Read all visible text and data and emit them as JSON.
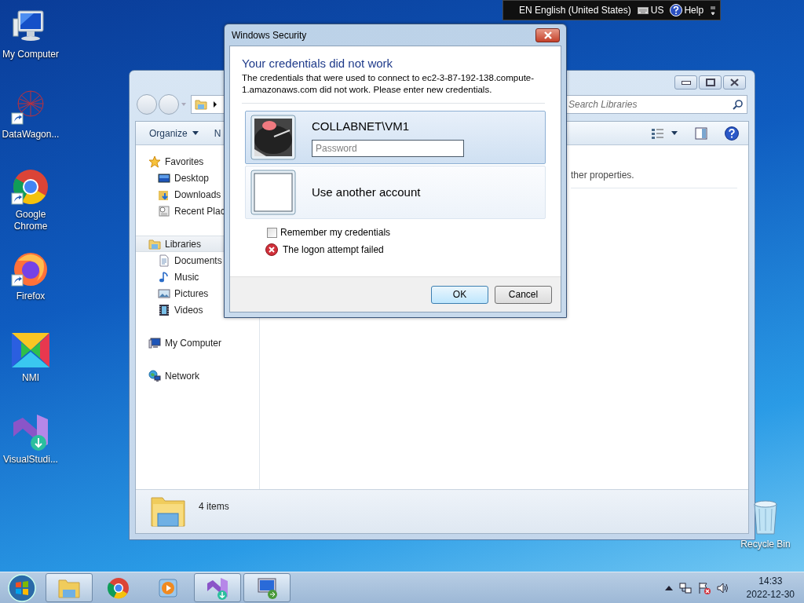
{
  "desktop_icons": [
    {
      "label": "My Computer",
      "kind": "computer"
    },
    {
      "label": "DataWagon...",
      "kind": "graph",
      "shortcut": true
    },
    {
      "label": "Google Chrome",
      "kind": "chrome",
      "shortcut": true
    },
    {
      "label": "Firefox",
      "kind": "firefox",
      "shortcut": true
    },
    {
      "label": "NMI",
      "kind": "nmi"
    },
    {
      "label": "VisualStudi...",
      "kind": "vs"
    },
    {
      "label": "Recycle Bin",
      "kind": "bin"
    }
  ],
  "language_bar": {
    "language": "EN English (United States)",
    "keyboard": "US",
    "help": "Help"
  },
  "explorer": {
    "search_placeholder": "Search Libraries",
    "toolbar": [
      "Organize",
      "N"
    ],
    "nav": [
      {
        "label": "Favorites",
        "kind": "star",
        "selected": false,
        "children": [
          {
            "label": "Desktop",
            "kind": "desktop",
            "selected": false
          },
          {
            "label": "Downloads",
            "kind": "downloads",
            "selected": false
          },
          {
            "label": "Recent Plac",
            "kind": "recent",
            "selected": false
          }
        ]
      },
      {
        "label": "Libraries",
        "kind": "library",
        "selected": true,
        "children": [
          {
            "label": "Documents",
            "kind": "documents",
            "selected": false
          },
          {
            "label": "Music",
            "kind": "music",
            "selected": false
          },
          {
            "label": "Pictures",
            "kind": "pictures",
            "selected": false
          },
          {
            "label": "Videos",
            "kind": "videos",
            "selected": false
          }
        ]
      },
      {
        "label": "My Computer",
        "kind": "computer",
        "selected": false
      },
      {
        "label": "Network",
        "kind": "network",
        "selected": false
      }
    ],
    "content_text": "ther properties.",
    "status": "4 items"
  },
  "dialog": {
    "title": "Windows Security",
    "heading": "Your credentials did not work",
    "message": "The credentials that were used to connect to ec2-3-87-192-138.compute-1.amazonaws.com did not work. Please enter new credentials.",
    "tiles": [
      {
        "kind": "user",
        "label": "COLLABNET\\VM1",
        "placeholder": "Password",
        "selected": true
      },
      {
        "kind": "other",
        "label": "Use another account",
        "selected": false
      }
    ],
    "remember": {
      "label": "Remember my credentials",
      "checked": false
    },
    "error": "The logon attempt failed",
    "buttons": [
      "OK",
      "Cancel"
    ]
  },
  "taskbar": {
    "apps": [
      {
        "kind": "explorer",
        "running": true
      },
      {
        "kind": "chrome",
        "running": false
      },
      {
        "kind": "media",
        "running": false
      },
      {
        "kind": "vs",
        "running": true
      },
      {
        "kind": "rdp",
        "running": true
      }
    ],
    "time": "14:33",
    "date": "2022-12-30"
  }
}
